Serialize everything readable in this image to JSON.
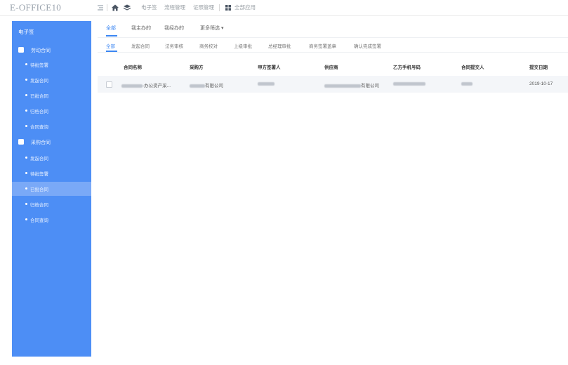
{
  "app": {
    "brand": "E-OFFICE10"
  },
  "topnav": {
    "items": [
      "电子签",
      "流程管理",
      "证照管理"
    ],
    "all_apps": "全部应用"
  },
  "sidebar": {
    "title": "电子签",
    "groups": [
      {
        "label": "劳动合同",
        "items": [
          "待批签署",
          "发起合同",
          "已批合同",
          "归档合同",
          "合同查询"
        ]
      },
      {
        "label": "采购合同",
        "items": [
          "发起合同",
          "待批签署",
          "已批合同",
          "归档合同",
          "合同查询"
        ]
      }
    ]
  },
  "tabs_primary": {
    "items": [
      "全部",
      "我主办的",
      "我经办的",
      "更多筛选 ▾"
    ]
  },
  "tabs_secondary": {
    "items": [
      "全部",
      "发起合同",
      "法务审核",
      "商务校对",
      "上级审批",
      "总经理审批",
      "商务签署盖章",
      "确认完成签署"
    ]
  },
  "table": {
    "columns": [
      "合同名称",
      "采购方",
      "甲方签署人",
      "供应商",
      "乙方手机号码",
      "合同提交人",
      "提交日期"
    ],
    "rows": [
      {
        "name": "-办公资产采...",
        "buyer": "有限公司",
        "supplier": "有限公司",
        "date": "2019-10-17"
      }
    ]
  },
  "colors": {
    "sidebar": "#4d8ef5",
    "accent": "#3b86f2"
  }
}
